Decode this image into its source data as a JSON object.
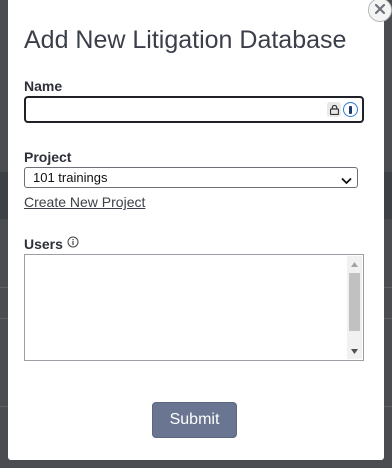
{
  "dialog": {
    "title": "Add New Litigation Database",
    "close_icon": "close-icon"
  },
  "name_field": {
    "label": "Name",
    "value": "",
    "placeholder": "",
    "icons": [
      "lock-icon",
      "password-manager-icon"
    ]
  },
  "project_field": {
    "label": "Project",
    "selected": "101 trainings",
    "create_link": "Create New Project"
  },
  "users_field": {
    "label": "Users",
    "info_icon": "info-icon"
  },
  "submit_label": "Submit",
  "colors": {
    "submit_bg": "#6a7591",
    "title_text": "#3b3f49",
    "input_border": "#1f2127",
    "backdrop": "#4a4c50"
  }
}
